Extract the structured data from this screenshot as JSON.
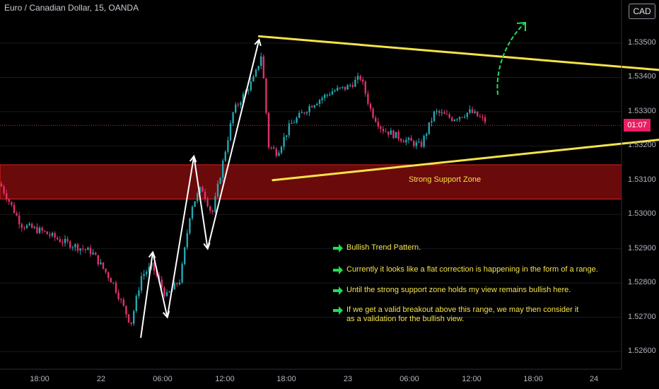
{
  "header": {
    "title": "Euro / Canadian Dollar, 15, OANDA"
  },
  "currency_button": "CAD",
  "current_price_badge": "01:07",
  "colors": {
    "background": "#000000",
    "bull_candle": "#26a6b0",
    "bear_candle": "#e0306a",
    "trendline": "#f5e34a",
    "support_zone": "#6b0a0a",
    "support_border": "#e02020",
    "green_arrow": "#22dd55",
    "zigzag": "#ffffff"
  },
  "annotations": {
    "support_zone_label": "Strong Support Zone",
    "notes": [
      "Bullish Trend Pattern.",
      "Currently it looks like a flat correction is happening in the form of a range.",
      "Until the strong support zone holds my view remains bullish here.",
      "If we get a valid breakout above this range, we may then consider it as a validation for the bullish view."
    ]
  },
  "chart_data": {
    "type": "candlestick",
    "title": "Euro / Canadian Dollar, 15, OANDA",
    "y_ticks": [
      "1.53500",
      "1.53400",
      "1.53300",
      "1.53200",
      "1.53100",
      "1.53000",
      "1.52900",
      "1.52800",
      "1.52700",
      "1.52600"
    ],
    "x_ticks": [
      "18:00",
      "22",
      "06:00",
      "12:00",
      "18:00",
      "23",
      "06:00",
      "12:00",
      "18:00",
      "24"
    ],
    "ylim": [
      1.5255,
      1.5362
    ],
    "current_price": 1.5326,
    "support_zone": [
      1.53045,
      1.53145
    ],
    "triangle": {
      "upper": {
        "from": {
          "x": "21 15:20",
          "y": 1.5352
        },
        "to": {
          "x": "23 22:45",
          "y": 1.5338
        }
      },
      "lower": {
        "from": {
          "x": "21 16:40",
          "y": 1.531
        },
        "to": {
          "x": "23 22:45",
          "y": 1.5327
        }
      }
    },
    "price_path_sketch": [
      {
        "x": "21 03:50",
        "y": 1.5264
      },
      {
        "x": "21 05:00",
        "y": 1.5289
      },
      {
        "x": "21 06:25",
        "y": 1.527
      },
      {
        "x": "21 09:00",
        "y": 1.5317
      },
      {
        "x": "21 10:20",
        "y": 1.529
      },
      {
        "x": "21 15:20",
        "y": 1.5351
      }
    ]
  }
}
